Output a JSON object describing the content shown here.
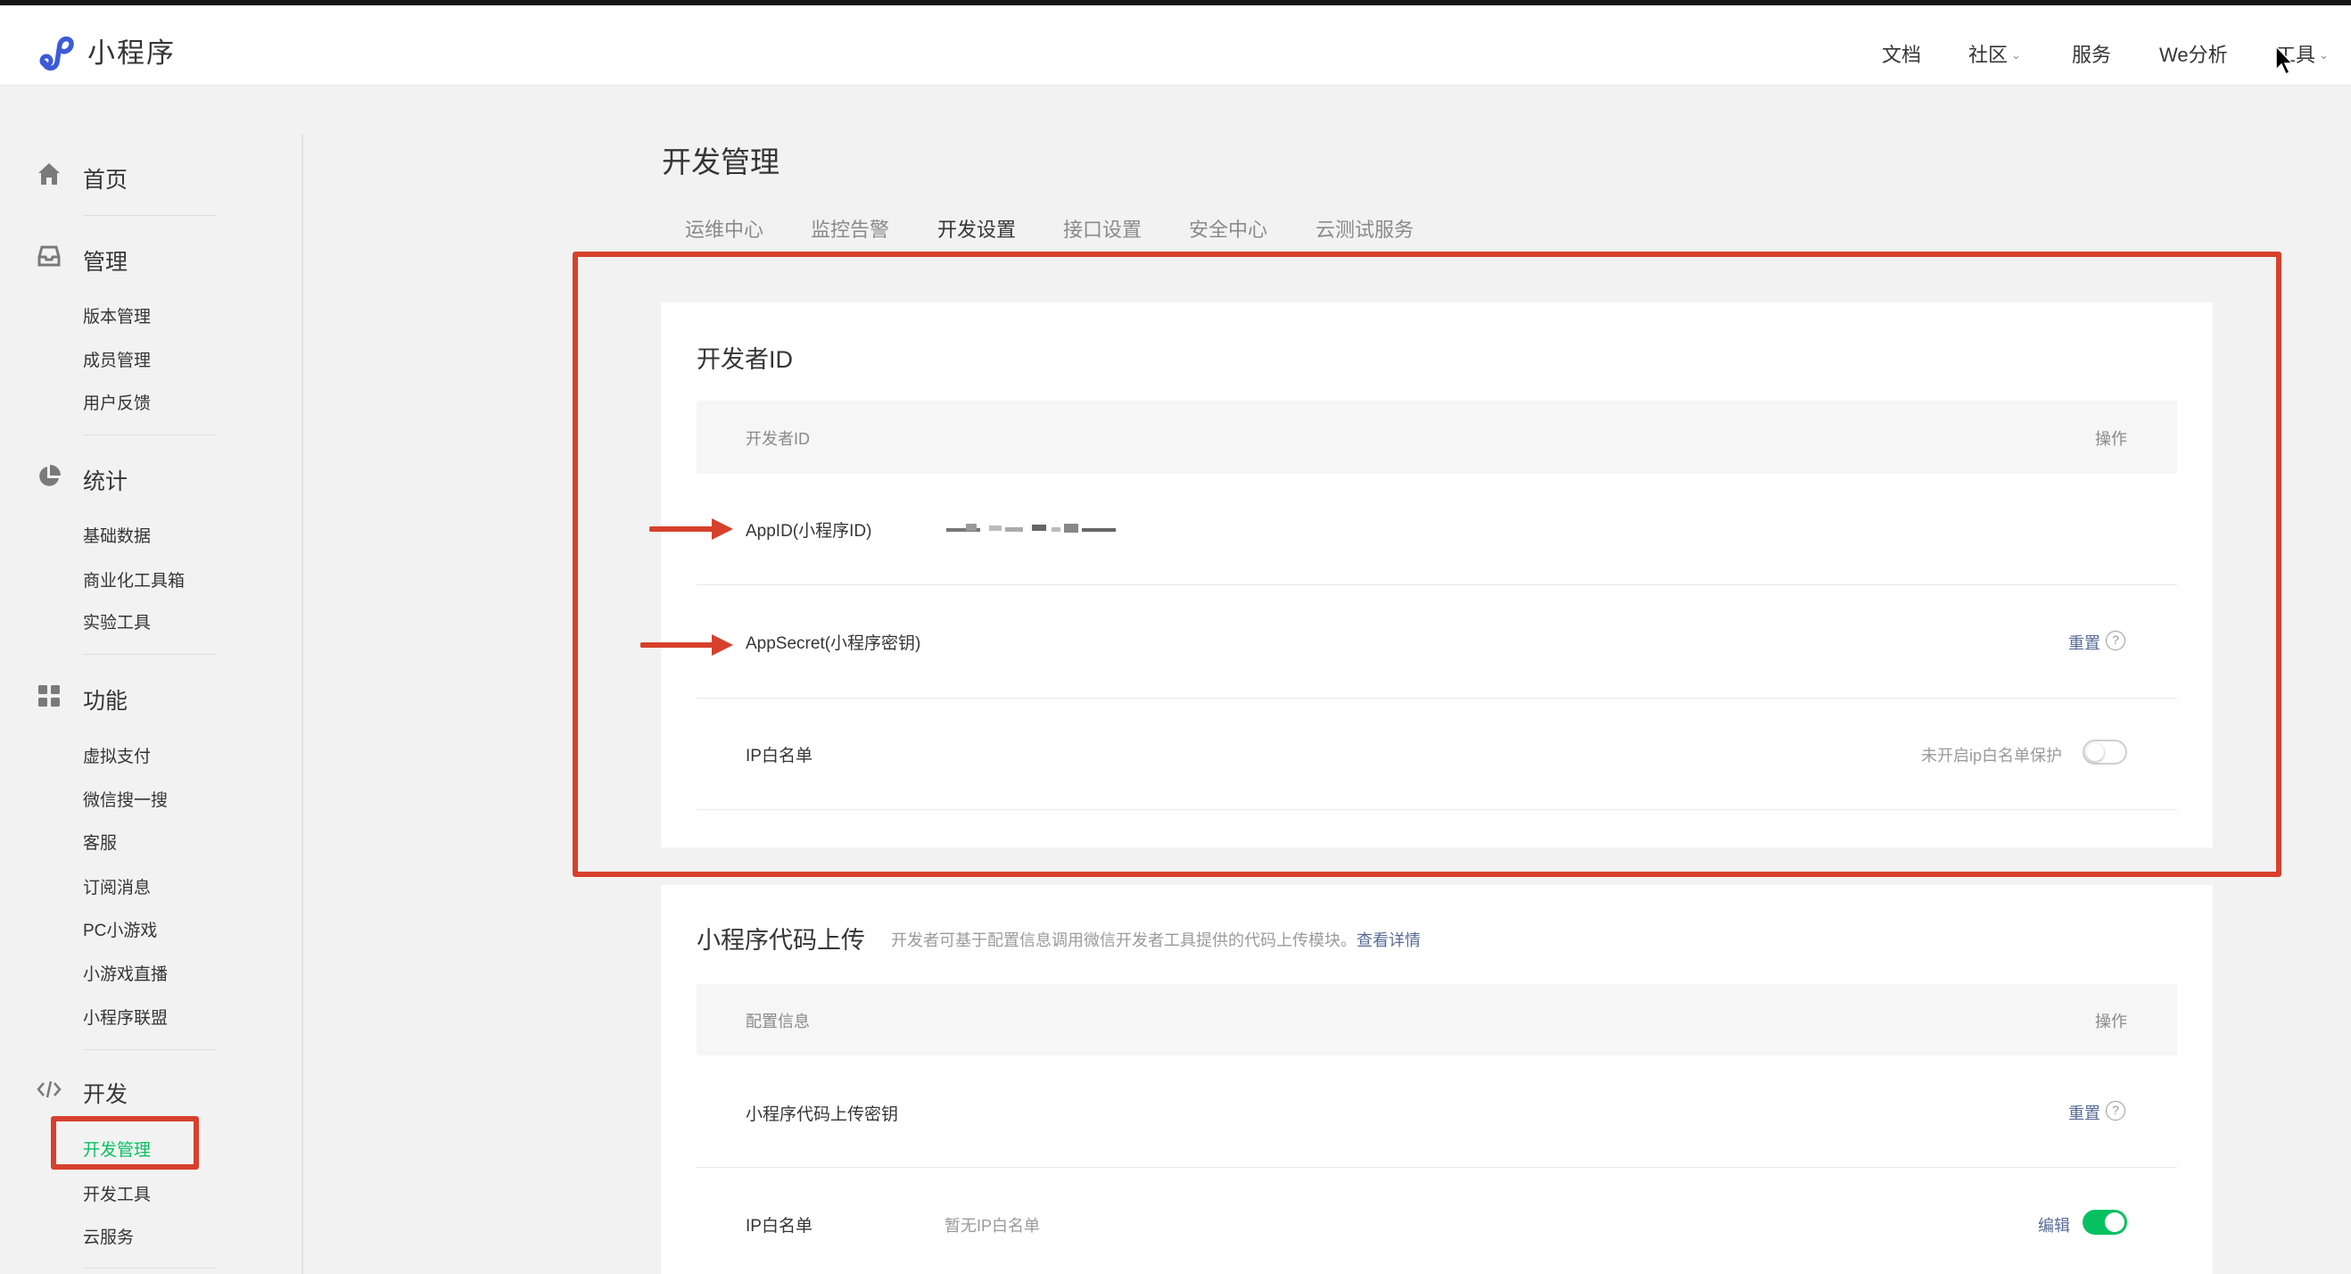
{
  "header": {
    "brand": "小程序",
    "nav": [
      {
        "label": "文档",
        "dropdown": false
      },
      {
        "label": "社区",
        "dropdown": true
      },
      {
        "label": "服务",
        "dropdown": false
      },
      {
        "label": "We分析",
        "dropdown": false
      },
      {
        "label": "工具",
        "dropdown": true
      }
    ]
  },
  "sidebar": {
    "home": {
      "label": "首页",
      "icon": "home-icon"
    },
    "manage": {
      "label": "管理",
      "icon": "inbox-icon",
      "items": [
        "版本管理",
        "成员管理",
        "用户反馈"
      ]
    },
    "stats": {
      "label": "统计",
      "icon": "pie-chart-icon",
      "items": [
        "基础数据",
        "商业化工具箱",
        "实验工具"
      ]
    },
    "features": {
      "label": "功能",
      "icon": "grid-icon",
      "items": [
        "虚拟支付",
        "微信搜一搜",
        "客服",
        "订阅消息",
        "PC小游戏",
        "小游戏直播",
        "小程序联盟"
      ]
    },
    "develop": {
      "label": "开发",
      "icon": "code-icon",
      "items": [
        "开发管理",
        "开发工具",
        "云服务"
      ],
      "active_index": 0
    }
  },
  "page": {
    "title": "开发管理",
    "tabs": [
      "运维中心",
      "监控告警",
      "开发设置",
      "接口设置",
      "安全中心",
      "云测试服务"
    ],
    "active_tab": 2
  },
  "developer_id": {
    "title": "开发者ID",
    "col_name": "开发者ID",
    "col_action": "操作",
    "appid_label": "AppID(小程序ID)",
    "appid_value_hidden": true,
    "appsecret_label": "AppSecret(小程序密钥)",
    "appsecret_action": "重置",
    "ip_label": "IP白名单",
    "ip_status": "未开启ip白名单保护",
    "ip_toggle_on": false
  },
  "code_upload": {
    "title": "小程序代码上传",
    "desc": "开发者可基于配置信息调用微信开发者工具提供的代码上传模块。",
    "desc_link": "查看详情",
    "col_name": "配置信息",
    "col_action": "操作",
    "key_label": "小程序代码上传密钥",
    "key_action": "重置",
    "ip_label": "IP白名单",
    "ip_value": "暂无IP白名单",
    "ip_action": "编辑",
    "ip_toggle_on": true
  },
  "colors": {
    "accent_green": "#07c160",
    "link_blue": "#576b95",
    "annotation_red": "#d7402c",
    "logo_blue": "#3b5bd9"
  }
}
